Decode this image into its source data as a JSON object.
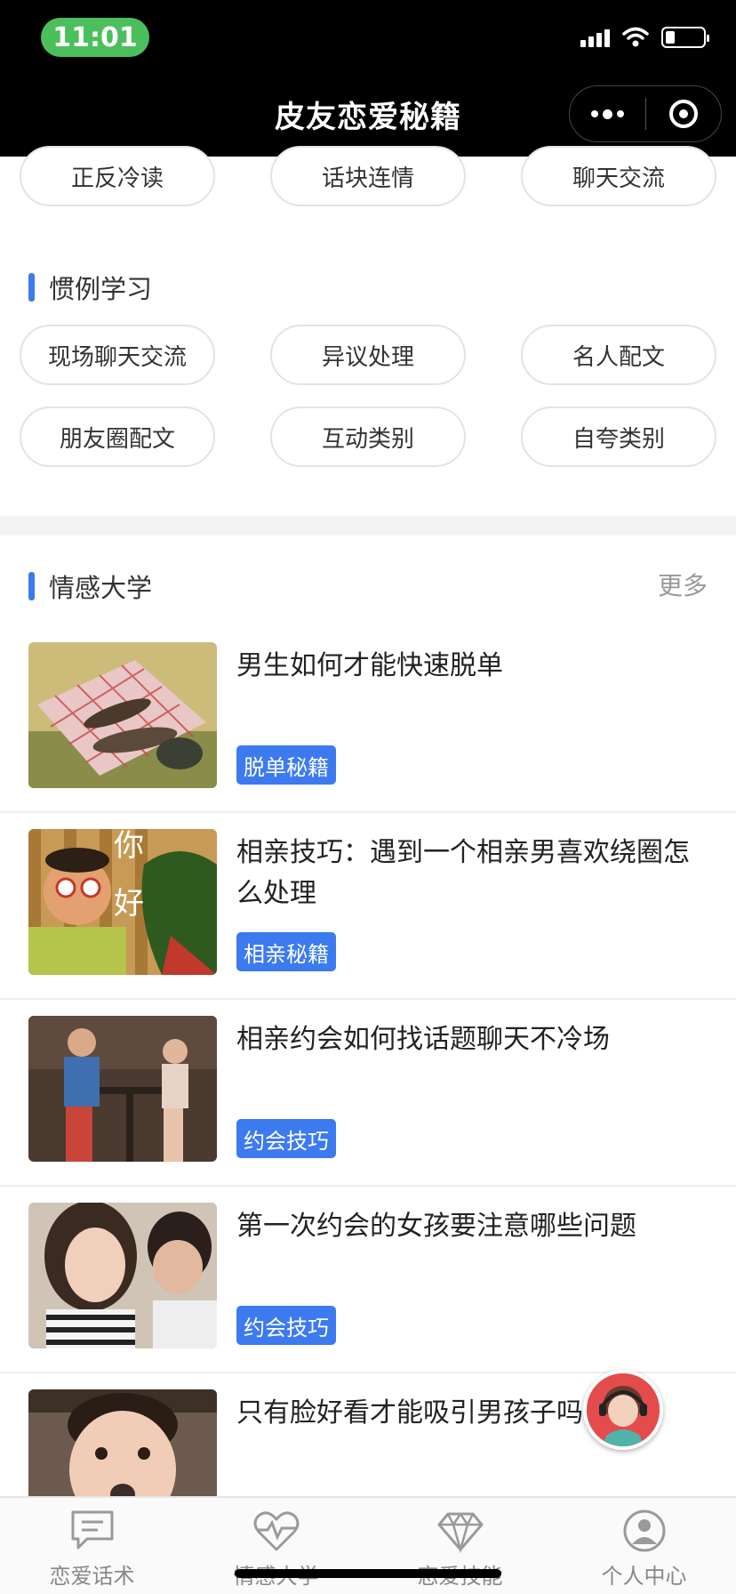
{
  "status_bar": {
    "time": "11:01",
    "battery_level": 0.25
  },
  "nav": {
    "title": "皮友恋爱秘籍",
    "more_icon": "more-dots-icon",
    "close_icon": "target-icon"
  },
  "chips_top": [
    "正反冷读",
    "话块连情",
    "聊天交流"
  ],
  "section_learn": {
    "title": "惯例学习",
    "chips": [
      "现场聊天交流",
      "异议处理",
      "名人配文",
      "朋友圈配文",
      "互动类别",
      "自夸类别"
    ]
  },
  "section_university": {
    "title": "情感大学",
    "more": "更多",
    "articles": [
      {
        "title": "男生如何才能快速脱单",
        "tag": "脱单秘籍"
      },
      {
        "title": "相亲技巧：遇到一个相亲男喜欢绕圈怎么处理",
        "tag": "相亲秘籍"
      },
      {
        "title": "相亲约会如何找话题聊天不冷场",
        "tag": "约会技巧"
      },
      {
        "title": "第一次约会的女孩要注意哪些问题",
        "tag": "约会技巧"
      },
      {
        "title": "只有脸好看才能吸引男孩子吗",
        "tag": ""
      }
    ]
  },
  "tabbar": [
    {
      "label": "恋爱话术",
      "icon": "chat-bubble-icon"
    },
    {
      "label": "情感大学",
      "icon": "heart-pulse-icon"
    },
    {
      "label": "恋爱技能",
      "icon": "diamond-icon"
    },
    {
      "label": "个人中心",
      "icon": "user-icon"
    }
  ],
  "colors": {
    "accent": "#3c7af0",
    "time_pill": "#4cbf5d",
    "support": "#e44c4c"
  }
}
